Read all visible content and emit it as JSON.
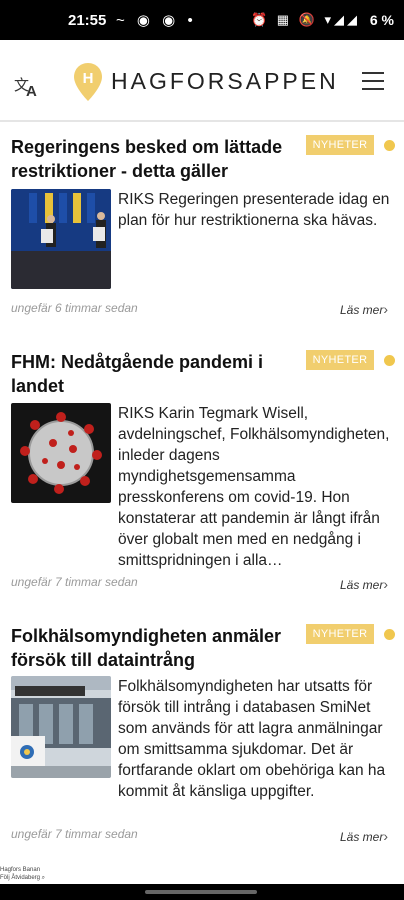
{
  "status_bar": {
    "time": "21:55",
    "left_icons": "~ ◉ ◉ •",
    "right_icons": "⏰ ▦ 🔕 ▾◢◢",
    "battery": "6 %"
  },
  "header": {
    "logo_text": "HAGFORSAPPEN",
    "logo_letter": "H",
    "translate_icon_glyphs": [
      "文",
      "A"
    ],
    "brand_color": "#f1ce6e"
  },
  "articles": [
    {
      "title": "Regeringens besked om lättade restriktioner - detta gäller",
      "category": "NYHETER",
      "excerpt": "RIKS Regeringen presenterade idag en plan för hur restriktionerna ska hävas.",
      "timestamp": "ungefär 6 timmar sedan",
      "read_more": "Läs mer"
    },
    {
      "title": "FHM: Nedåtgående pandemi i landet",
      "category": "NYHETER",
      "excerpt": "RIKS Karin Tegmark Wisell, avdelningschef, Folkhälsomyndigheten, inleder dagens myndighetsgemensamma presskonferens om covid-19. Hon konstaterar att pandemin är långt ifrån över globalt men med en nedgång i smittspridningen i alla…",
      "timestamp": "ungefär 7 timmar sedan",
      "read_more": "Läs mer"
    },
    {
      "title": "Folkhälsomyndigheten anmäler försök till dataintrång",
      "category": "NYHETER",
      "excerpt": "Folkhälsomyndigheten har utsatts för försök till intrång i databasen SmiNet som används för att lagra anmälningar om smittsamma sjukdomar. Det är fortfarande oklart om obehöriga kan ha kommit åt känsliga uppgifter.",
      "timestamp": "ungefär 7 timmar sedan",
      "read_more": "Läs mer"
    }
  ],
  "footer": {
    "line1": "Hagfors Banan",
    "line2": "Följ Åtvidaberg ⌕"
  }
}
